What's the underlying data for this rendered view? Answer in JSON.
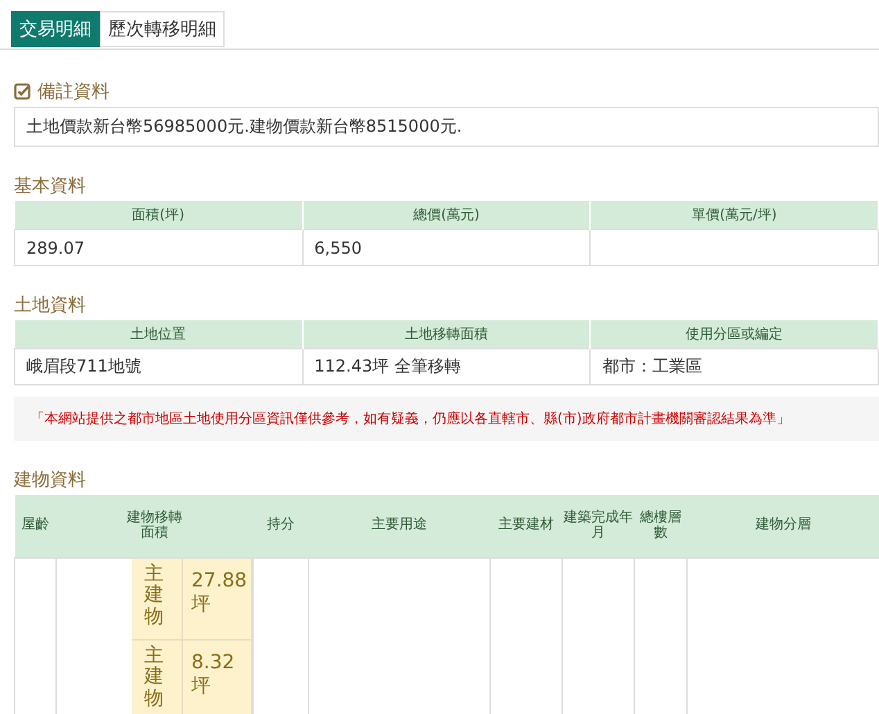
{
  "tabs": [
    {
      "label": "交易明細",
      "selected": true
    },
    {
      "label": "歷次轉移明細",
      "selected": false
    }
  ],
  "remarks": {
    "title": "備註資料",
    "text": "土地價款新台幣56985000元.建物價款新台幣8515000元."
  },
  "basic": {
    "title": "基本資料",
    "columns": [
      "面積(坪)",
      "總價(萬元)",
      "單價(萬元/坪)"
    ],
    "rows": [
      [
        "289.07",
        "6,550"
      ]
    ]
  },
  "land": {
    "title": "土地資料",
    "columns": [
      "土地位置",
      "土地移轉面積",
      "使用分區或編定"
    ],
    "rows": [
      [
        "峨眉段711地號",
        "112.43坪 全筆移轉",
        "都市：工業區"
      ]
    ]
  },
  "disclaimer": "「本網站提供之都市地區土地使用分區資訊僅供參考，如有疑義，仍應以各直轄市、縣(市)政府都市計畫機關審認結果為準」",
  "building": {
    "title": "建物資料",
    "columns": [
      "屋齡",
      "建物移轉面積",
      "持分",
      "主要用途",
      "主要建材",
      "建築完成年月",
      "總樓層數",
      "建物分層"
    ],
    "areas": [
      {
        "type": "主建物",
        "area": "27.88坪"
      },
      {
        "type": "主建物",
        "area": "8.32坪"
      }
    ]
  }
}
